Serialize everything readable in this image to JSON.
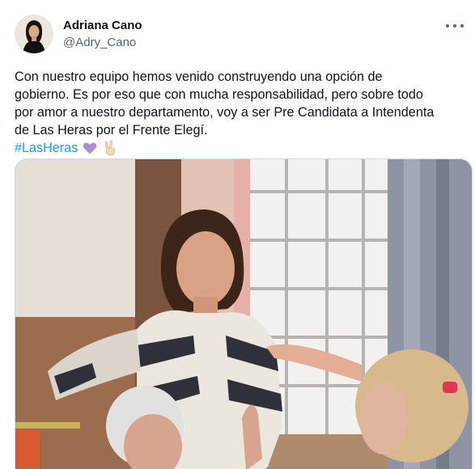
{
  "tweet": {
    "author_name": "Adriana Cano",
    "author_handle": "@Adry_Cano",
    "text_lines": [
      "Con nuestro equipo hemos venido construyendo una opción de",
      "gobierno. Es por eso que con mucha responsabilidad, pero sobre todo",
      "por amor a nuestro departamento, voy a ser Pre Candidata a Intendenta",
      "de Las Heras por el Frente Elegí."
    ],
    "hashtag": "#LasHeras",
    "emojis": [
      "purple-heart-icon",
      "victory-hand-icon"
    ]
  },
  "colors": {
    "link": "#1d9bf0",
    "text": "#0f1419",
    "secondary": "#536471",
    "border": "#cfd9de"
  }
}
